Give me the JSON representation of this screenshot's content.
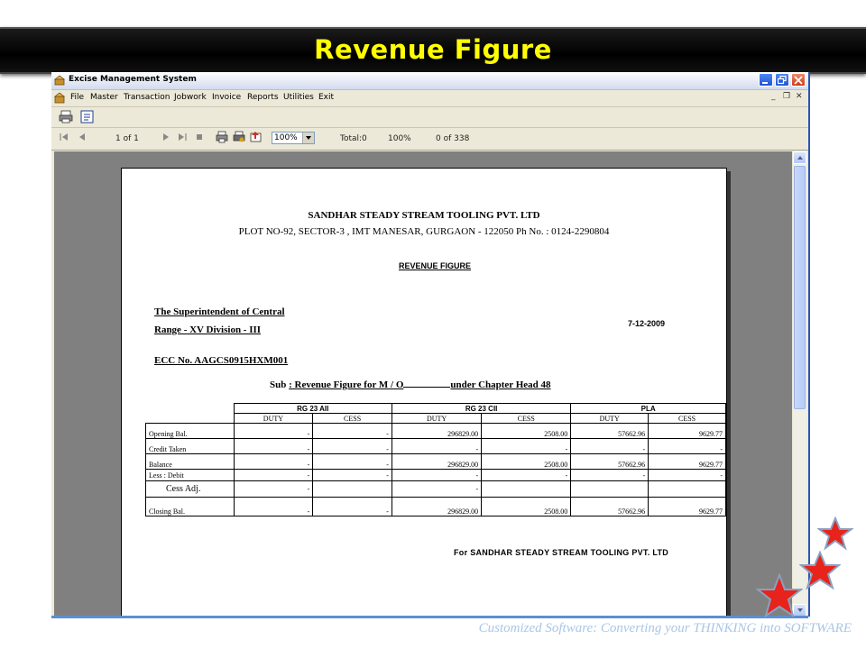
{
  "slide": {
    "title": "Revenue Figure",
    "footer_tagline": "Customized Software:  Converting your THINKING into SOFTWARE"
  },
  "window": {
    "title": "Excise Management System",
    "menu": [
      "File",
      "Master",
      "Transaction",
      "Jobwork",
      "Invoice",
      "Reports",
      "Utilities",
      "Exit"
    ],
    "toolbar": {
      "page_indicator": "1 of 1",
      "zoom": "100%",
      "total": "Total:0",
      "percent": "100%",
      "records": "0 of 338"
    }
  },
  "report": {
    "company_name": "SANDHAR STEADY STREAM TOOLING PVT. LTD",
    "company_address": "PLOT NO-92, SECTOR-3 , IMT MANESAR, GURGAON - 122050 Ph No. : 0124-2290804",
    "title": "REVENUE FIGURE",
    "addressee_line1": "The Superintendent of Central",
    "addressee_line2": "Range - XV  Division -  III",
    "date": "7-12-2009",
    "ecc": "ECC No. AAGCS0915HXM001",
    "subject_prefix": "Sub ",
    "subject_text": ": Revenue Figure for M / O",
    "subject_suffix": "under Chapter Head  48",
    "signature": "For  SANDHAR STEADY STREAM TOOLING PVT. LTD",
    "table": {
      "groups": [
        "RG 23 AII",
        "RG 23 CII",
        "PLA"
      ],
      "subheaders": [
        "DUTY",
        "CESS",
        "DUTY",
        "CESS",
        "DUTY",
        "CESS"
      ],
      "rows": [
        {
          "label": "Opening Bal.",
          "values": [
            "-",
            "-",
            "296829.00",
            "2508.00",
            "57662.96",
            "9629.77"
          ]
        },
        {
          "label": "Credit Taken",
          "values": [
            "-",
            "-",
            "-",
            "-",
            "-",
            "-"
          ]
        },
        {
          "label": "Balance",
          "values": [
            "-",
            "-",
            "296829.00",
            "2508.00",
            "57662.96",
            "9629.77"
          ]
        },
        {
          "label": "Less : Debit",
          "values": [
            "-",
            "-",
            "-",
            "-",
            "-",
            "-"
          ]
        },
        {
          "label": "Cess Adj.",
          "values": [
            "-",
            "",
            "-",
            "",
            "",
            ""
          ]
        },
        {
          "label": "Closing Bal.",
          "values": [
            "-",
            "-",
            "296829.00",
            "2508.00",
            "57662.96",
            "9629.77"
          ]
        }
      ]
    }
  },
  "colors": {
    "banner_bg": "#000000",
    "banner_text": "#ffff00",
    "star_red": "#e8231b",
    "star_outline": "#8aa0c0",
    "footer_text": "#a9c6e6"
  }
}
